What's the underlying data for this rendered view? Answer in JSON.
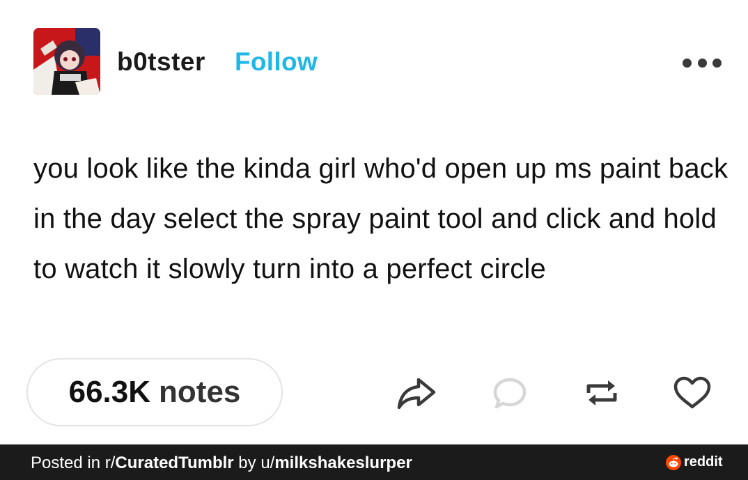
{
  "post": {
    "username": "b0tster",
    "follow_label": "Follow",
    "body": "you look like the kinda girl who'd open up ms paint back in the day select the spray paint tool and click and hold to watch it slowly turn into a perfect circle",
    "notes_count": "66.3K",
    "notes_label": "notes"
  },
  "icons": {
    "more": "more-dots-icon",
    "share": "share-arrow-icon",
    "reply": "reply-bubble-icon",
    "reblog": "reblog-icon",
    "like": "heart-icon"
  },
  "footer": {
    "prefix": "Posted in r/",
    "subreddit": "CuratedTumblr",
    "by": " by u/",
    "user": "milkshakeslurper",
    "brand": "reddit"
  },
  "colors": {
    "follow": "#1fb7e6",
    "footer_bg": "#1b1b1b",
    "reddit_orange": "#ff4500",
    "avatar_bg": "#c8171b"
  }
}
